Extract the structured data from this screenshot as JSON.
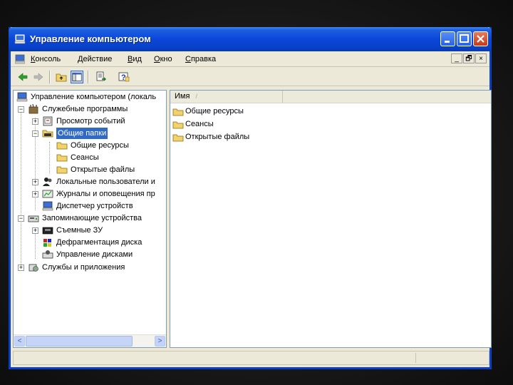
{
  "window": {
    "title": "Управление компьютером",
    "accent": "#0a46d8"
  },
  "menubar": {
    "items": [
      {
        "label": "Консоль",
        "key": "К",
        "rest": "онсоль"
      },
      {
        "label": "Действие",
        "key": "Д",
        "rest": "ействие"
      },
      {
        "label": "Вид",
        "key": "В",
        "rest": "ид"
      },
      {
        "label": "Окно",
        "key": "О",
        "rest": "кно"
      },
      {
        "label": "Справка",
        "key": "С",
        "rest": "правка"
      }
    ],
    "mdi": {
      "minimize": "_",
      "restore": "🗗",
      "close": "×"
    }
  },
  "toolbar": {
    "icons": [
      "back-arrow-icon",
      "forward-arrow-icon",
      "up-folder-icon",
      "show-hide-tree-icon",
      "export-list-icon",
      "help-icon"
    ]
  },
  "tree": {
    "root": "Управление компьютером (локаль",
    "items": [
      {
        "label": "Служебные программы",
        "expander": "−"
      },
      {
        "label": "Просмотр событий",
        "expander": "+"
      },
      {
        "label": "Общие папки",
        "expander": "−",
        "selected": true
      },
      {
        "label": "Общие ресурсы"
      },
      {
        "label": "Сеансы"
      },
      {
        "label": "Открытые файлы"
      },
      {
        "label": "Локальные пользователи и",
        "expander": "+"
      },
      {
        "label": "Журналы и оповещения пр",
        "expander": "+"
      },
      {
        "label": "Диспетчер устройств"
      },
      {
        "label": "Запоминающие устройства",
        "expander": "−"
      },
      {
        "label": "Съемные ЗУ",
        "expander": "+"
      },
      {
        "label": "Дефрагментация диска"
      },
      {
        "label": "Управление дисками"
      },
      {
        "label": "Службы и приложения",
        "expander": "+"
      }
    ]
  },
  "list": {
    "column": "Имя",
    "sort_glyph": "/",
    "items": [
      "Общие ресурсы",
      "Сеансы",
      "Открытые файлы"
    ]
  },
  "scroll": {
    "left": "<",
    "right": ">"
  }
}
